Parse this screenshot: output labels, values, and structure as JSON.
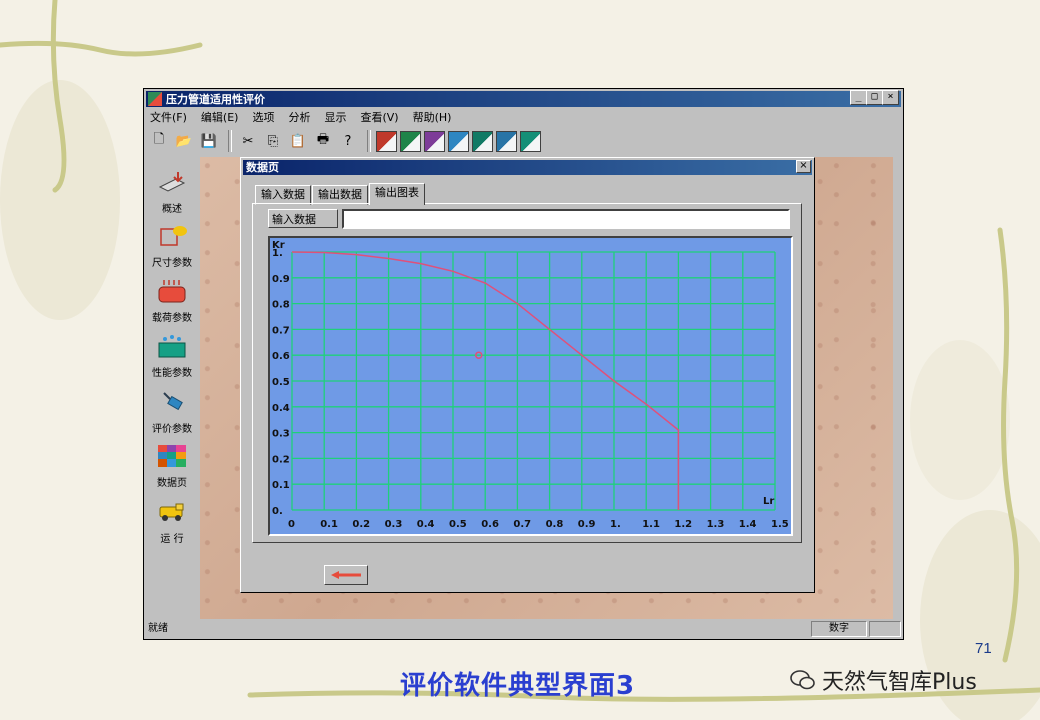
{
  "slide": {
    "page_number": "71",
    "caption": "评价软件典型界面3",
    "watermark": "天然气智库Plus"
  },
  "window": {
    "title": "压力管道适用性评价",
    "controls": [
      "_",
      "□",
      "×"
    ],
    "menu": [
      "文件(F)",
      "编辑(E)",
      "选项",
      "分析",
      "显示",
      "查看(V)",
      "帮助(H)"
    ],
    "toolbar": {
      "buttons": [
        "new-icon",
        "open-icon",
        "save-icon",
        "cut-icon",
        "copy-icon",
        "paste-icon",
        "print-icon",
        "help-icon"
      ],
      "glyphs": [
        "🗋",
        "📂",
        "💾",
        "✂",
        "⎘",
        "📋",
        "🖶",
        "?"
      ],
      "colors": [
        "#c0392b",
        "#1e8449",
        "#7d3c98",
        "#2e86c1",
        "#117a65",
        "#2874a6",
        "#148f77"
      ]
    },
    "status": {
      "left": "就绪",
      "right": "数字"
    }
  },
  "sidebar": {
    "items": [
      {
        "label": "概述",
        "icon": "overview-icon"
      },
      {
        "label": "尺寸参数",
        "icon": "dimension-icon"
      },
      {
        "label": "载荷参数",
        "icon": "load-icon"
      },
      {
        "label": "性能参数",
        "icon": "performance-icon"
      },
      {
        "label": "评价参数",
        "icon": "evaluation-icon"
      },
      {
        "label": "数据页",
        "icon": "data-page-icon"
      },
      {
        "label": "运  行",
        "icon": "run-icon"
      }
    ]
  },
  "dialog": {
    "title": "数据页",
    "close": "×",
    "tabs": [
      "输入数据",
      "输出数据",
      "输出图表"
    ],
    "active_tab": 2,
    "input_label": "输入数据",
    "input_value": ""
  },
  "chart_data": {
    "type": "line",
    "xlabel": "Lr",
    "ylabel": "Kr",
    "xlim": [
      0,
      1.5
    ],
    "ylim": [
      0,
      1.0
    ],
    "x_ticks": [
      "0",
      "0.1",
      "0.2",
      "0.3",
      "0.4",
      "0.5",
      "0.6",
      "0.7",
      "0.8",
      "0.9",
      "1.",
      "1.1",
      "1.2",
      "1.3",
      "1.4",
      "1.5"
    ],
    "y_ticks": [
      "0.",
      "0.1",
      "0.2",
      "0.3",
      "0.4",
      "0.5",
      "0.6",
      "0.7",
      "0.8",
      "0.9",
      "1."
    ],
    "grid": true,
    "background": "#6f9ae6",
    "grid_color": "#1fd07a",
    "series": [
      {
        "color": "#e0507a",
        "x": [
          0,
          0.1,
          0.2,
          0.3,
          0.4,
          0.5,
          0.6,
          0.7,
          0.8,
          0.9,
          1.0,
          1.1,
          1.2,
          1.2
        ],
        "y": [
          1.0,
          0.998,
          0.99,
          0.975,
          0.955,
          0.925,
          0.88,
          0.8,
          0.7,
          0.6,
          0.5,
          0.41,
          0.31,
          0.0
        ]
      }
    ],
    "points": [
      {
        "x": 0.58,
        "y": 0.6,
        "color": "#e0507a"
      }
    ]
  }
}
